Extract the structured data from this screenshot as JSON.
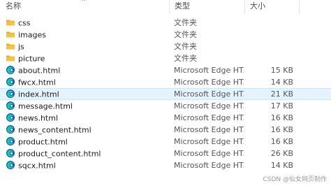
{
  "columns": {
    "name": "名称",
    "type": "类型",
    "size": "大小"
  },
  "files": [
    {
      "name": "css",
      "type": "文件夹",
      "size": "",
      "icon": "folder-icon"
    },
    {
      "name": "images",
      "type": "文件夹",
      "size": "",
      "icon": "folder-icon"
    },
    {
      "name": "js",
      "type": "文件夹",
      "size": "",
      "icon": "folder-icon"
    },
    {
      "name": "picture",
      "type": "文件夹",
      "size": "",
      "icon": "folder-icon"
    },
    {
      "name": "about.html",
      "type": "Microsoft Edge HT...",
      "size": "15 KB",
      "icon": "edge-html-icon"
    },
    {
      "name": "fwcx.html",
      "type": "Microsoft Edge HT...",
      "size": "14 KB",
      "icon": "edge-html-icon"
    },
    {
      "name": "index.html",
      "type": "Microsoft Edge HT...",
      "size": "21 KB",
      "icon": "edge-html-icon",
      "selected": true
    },
    {
      "name": "message.html",
      "type": "Microsoft Edge HT...",
      "size": "17 KB",
      "icon": "edge-html-icon"
    },
    {
      "name": "news.html",
      "type": "Microsoft Edge HT...",
      "size": "16 KB",
      "icon": "edge-html-icon"
    },
    {
      "name": "news_content.html",
      "type": "Microsoft Edge HT...",
      "size": "16 KB",
      "icon": "edge-html-icon"
    },
    {
      "name": "product.html",
      "type": "Microsoft Edge HT...",
      "size": "16 KB",
      "icon": "edge-html-icon"
    },
    {
      "name": "product_content.html",
      "type": "Microsoft Edge HT...",
      "size": "26 KB",
      "icon": "edge-html-icon"
    },
    {
      "name": "sqcx.html",
      "type": "Microsoft Edge HT...",
      "size": "14 KB",
      "icon": "edge-html-icon"
    }
  ],
  "watermark": "CSDN @仙女网页制作",
  "colors": {
    "folder": "#f5c242",
    "folder_dark": "#e0a82e",
    "edge_blue": "#0c59a4",
    "edge_teal": "#1fc3b6",
    "selection_bg": "#e5f3ff",
    "selection_border": "#cce8ff"
  }
}
